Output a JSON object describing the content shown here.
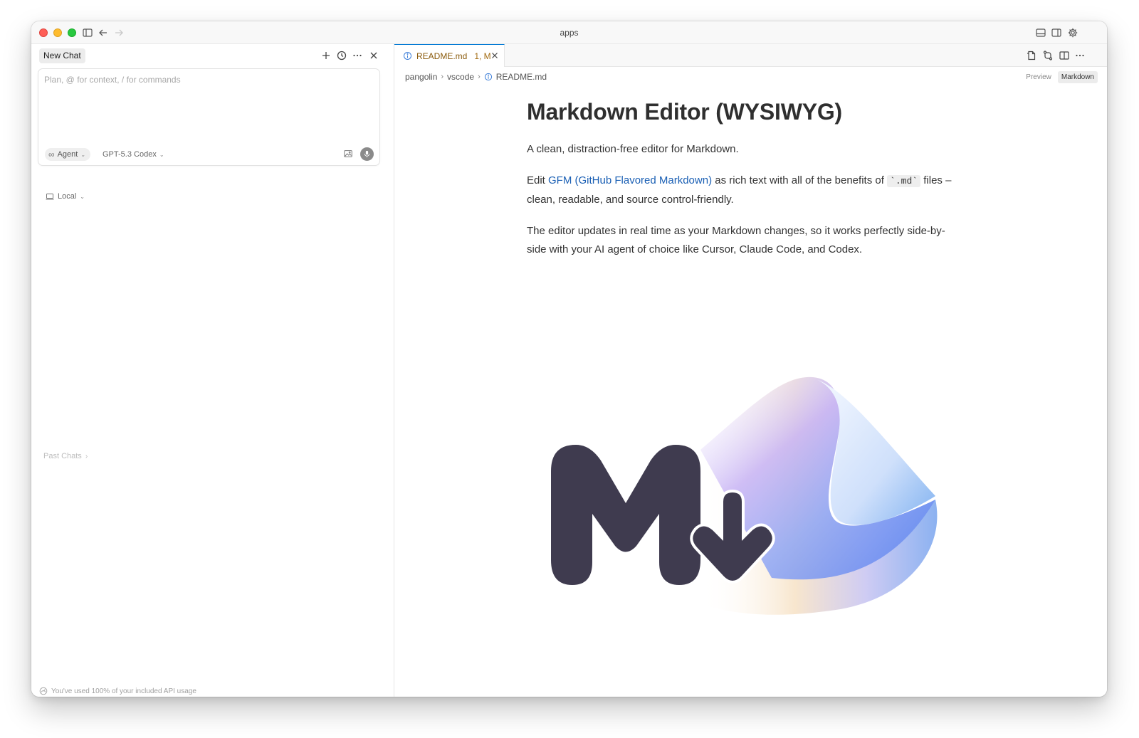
{
  "window": {
    "title": "apps"
  },
  "chat": {
    "tab_label": "New Chat",
    "input_placeholder": "Plan, @ for context, / for commands",
    "agent_label": "Agent",
    "model_label": "GPT-5.3 Codex",
    "location_label": "Local",
    "past_chats_label": "Past Chats",
    "usage_text": "You've used 100% of your included API usage"
  },
  "editor": {
    "tab": {
      "filename": "README.md",
      "status": "1, M"
    },
    "breadcrumb": [
      "pangolin",
      "vscode",
      "README.md"
    ],
    "modes": {
      "preview": "Preview",
      "markdown": "Markdown"
    },
    "document": {
      "title": "Markdown Editor (WYSIWYG)",
      "p1": "A clean, distraction-free editor for Markdown.",
      "p2_before": "Edit ",
      "p2_link": "GFM (GitHub Flavored Markdown)",
      "p2_middle": " as rich text with all of the benefits of ",
      "p2_code": "`.md`",
      "p2_after": " files – clean, readable, and source control-friendly.",
      "p3": "The editor updates in real time as your Markdown changes, so it works perfectly side-by-side with your AI agent of choice like Cursor, Claude Code, and Codex."
    }
  },
  "colors": {
    "accent": "#0078d4",
    "link": "#1a5fb4",
    "tab_filename": "#8a5a0b",
    "logo_dark": "#3f3b4f"
  },
  "icons": {
    "titlebar": [
      "sidebar-toggle-icon",
      "back-arrow-icon",
      "forward-arrow-icon",
      "panel-bottom-icon",
      "panel-right-icon",
      "settings-gear-icon"
    ],
    "chat_header": [
      "plus-icon",
      "history-clock-icon",
      "more-ellipsis-icon",
      "close-icon"
    ],
    "editor_toolbar": [
      "open-file-icon",
      "compare-changes-icon",
      "split-editor-icon",
      "more-ellipsis-icon"
    ]
  }
}
